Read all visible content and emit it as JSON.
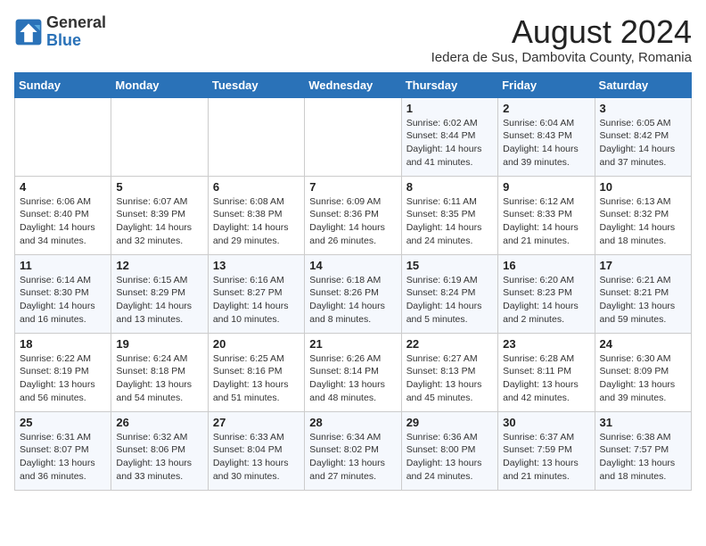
{
  "header": {
    "logo_general": "General",
    "logo_blue": "Blue",
    "month_year": "August 2024",
    "location": "Iedera de Sus, Dambovita County, Romania"
  },
  "days_of_week": [
    "Sunday",
    "Monday",
    "Tuesday",
    "Wednesday",
    "Thursday",
    "Friday",
    "Saturday"
  ],
  "weeks": [
    [
      {
        "day": "",
        "info": ""
      },
      {
        "day": "",
        "info": ""
      },
      {
        "day": "",
        "info": ""
      },
      {
        "day": "",
        "info": ""
      },
      {
        "day": "1",
        "info": "Sunrise: 6:02 AM\nSunset: 8:44 PM\nDaylight: 14 hours and 41 minutes."
      },
      {
        "day": "2",
        "info": "Sunrise: 6:04 AM\nSunset: 8:43 PM\nDaylight: 14 hours and 39 minutes."
      },
      {
        "day": "3",
        "info": "Sunrise: 6:05 AM\nSunset: 8:42 PM\nDaylight: 14 hours and 37 minutes."
      }
    ],
    [
      {
        "day": "4",
        "info": "Sunrise: 6:06 AM\nSunset: 8:40 PM\nDaylight: 14 hours and 34 minutes."
      },
      {
        "day": "5",
        "info": "Sunrise: 6:07 AM\nSunset: 8:39 PM\nDaylight: 14 hours and 32 minutes."
      },
      {
        "day": "6",
        "info": "Sunrise: 6:08 AM\nSunset: 8:38 PM\nDaylight: 14 hours and 29 minutes."
      },
      {
        "day": "7",
        "info": "Sunrise: 6:09 AM\nSunset: 8:36 PM\nDaylight: 14 hours and 26 minutes."
      },
      {
        "day": "8",
        "info": "Sunrise: 6:11 AM\nSunset: 8:35 PM\nDaylight: 14 hours and 24 minutes."
      },
      {
        "day": "9",
        "info": "Sunrise: 6:12 AM\nSunset: 8:33 PM\nDaylight: 14 hours and 21 minutes."
      },
      {
        "day": "10",
        "info": "Sunrise: 6:13 AM\nSunset: 8:32 PM\nDaylight: 14 hours and 18 minutes."
      }
    ],
    [
      {
        "day": "11",
        "info": "Sunrise: 6:14 AM\nSunset: 8:30 PM\nDaylight: 14 hours and 16 minutes."
      },
      {
        "day": "12",
        "info": "Sunrise: 6:15 AM\nSunset: 8:29 PM\nDaylight: 14 hours and 13 minutes."
      },
      {
        "day": "13",
        "info": "Sunrise: 6:16 AM\nSunset: 8:27 PM\nDaylight: 14 hours and 10 minutes."
      },
      {
        "day": "14",
        "info": "Sunrise: 6:18 AM\nSunset: 8:26 PM\nDaylight: 14 hours and 8 minutes."
      },
      {
        "day": "15",
        "info": "Sunrise: 6:19 AM\nSunset: 8:24 PM\nDaylight: 14 hours and 5 minutes."
      },
      {
        "day": "16",
        "info": "Sunrise: 6:20 AM\nSunset: 8:23 PM\nDaylight: 14 hours and 2 minutes."
      },
      {
        "day": "17",
        "info": "Sunrise: 6:21 AM\nSunset: 8:21 PM\nDaylight: 13 hours and 59 minutes."
      }
    ],
    [
      {
        "day": "18",
        "info": "Sunrise: 6:22 AM\nSunset: 8:19 PM\nDaylight: 13 hours and 56 minutes."
      },
      {
        "day": "19",
        "info": "Sunrise: 6:24 AM\nSunset: 8:18 PM\nDaylight: 13 hours and 54 minutes."
      },
      {
        "day": "20",
        "info": "Sunrise: 6:25 AM\nSunset: 8:16 PM\nDaylight: 13 hours and 51 minutes."
      },
      {
        "day": "21",
        "info": "Sunrise: 6:26 AM\nSunset: 8:14 PM\nDaylight: 13 hours and 48 minutes."
      },
      {
        "day": "22",
        "info": "Sunrise: 6:27 AM\nSunset: 8:13 PM\nDaylight: 13 hours and 45 minutes."
      },
      {
        "day": "23",
        "info": "Sunrise: 6:28 AM\nSunset: 8:11 PM\nDaylight: 13 hours and 42 minutes."
      },
      {
        "day": "24",
        "info": "Sunrise: 6:30 AM\nSunset: 8:09 PM\nDaylight: 13 hours and 39 minutes."
      }
    ],
    [
      {
        "day": "25",
        "info": "Sunrise: 6:31 AM\nSunset: 8:07 PM\nDaylight: 13 hours and 36 minutes."
      },
      {
        "day": "26",
        "info": "Sunrise: 6:32 AM\nSunset: 8:06 PM\nDaylight: 13 hours and 33 minutes."
      },
      {
        "day": "27",
        "info": "Sunrise: 6:33 AM\nSunset: 8:04 PM\nDaylight: 13 hours and 30 minutes."
      },
      {
        "day": "28",
        "info": "Sunrise: 6:34 AM\nSunset: 8:02 PM\nDaylight: 13 hours and 27 minutes."
      },
      {
        "day": "29",
        "info": "Sunrise: 6:36 AM\nSunset: 8:00 PM\nDaylight: 13 hours and 24 minutes."
      },
      {
        "day": "30",
        "info": "Sunrise: 6:37 AM\nSunset: 7:59 PM\nDaylight: 13 hours and 21 minutes."
      },
      {
        "day": "31",
        "info": "Sunrise: 6:38 AM\nSunset: 7:57 PM\nDaylight: 13 hours and 18 minutes."
      }
    ]
  ]
}
